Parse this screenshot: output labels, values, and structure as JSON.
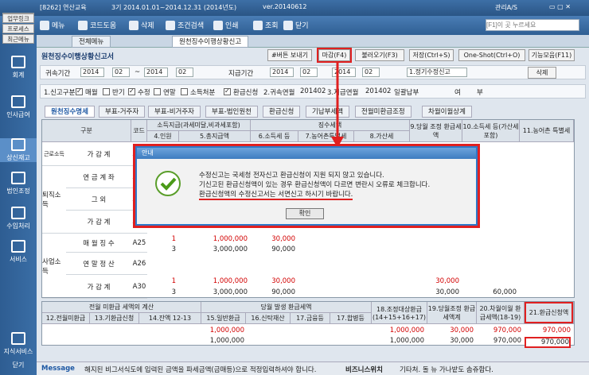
{
  "topbar": {
    "left": "[8262] 연산교육",
    "period": "3기  2014.01.01~2014.12.31  (2014년도)",
    "version": "ver.20140612",
    "user": "관리A/S"
  },
  "toolbar": {
    "menu": "메뉴",
    "code_help": "코드도움",
    "delete": "삭제",
    "filter": "조건검색",
    "print": "인쇄",
    "inquiry": "조회",
    "close": "닫기",
    "search_placeholder": "[F1]이 곳 누르세요"
  },
  "sidebar": {
    "btn1": "업무링크",
    "btn2": "프로세스",
    "btn3": "최근메뉴",
    "items": [
      "회계",
      "인사급여",
      "상신재고",
      "법인조정",
      "수입처리",
      "서비스",
      "지식서비스",
      "닫기"
    ]
  },
  "page_tabs": {
    "all": "전체메뉴",
    "active": "원천징수이행상황신고"
  },
  "form": {
    "title": "원천징수이행상황신고서",
    "btn_help": "#버튼 보내기",
    "btn_close": "마감(F4)",
    "btn_load": "불러오기(F3)",
    "btn_save": "저장(Ctrl+S)",
    "btn_oneshot": "One-Shot(Ctrl+O)",
    "btn_func": "기능모음(F11)",
    "btn_del": "삭제"
  },
  "filter": {
    "label1": "귀속기간",
    "y1": "2014",
    "m1": "02",
    "sep1": "년",
    "mon1": "월",
    "tilde": "~",
    "y2": "2014",
    "m2": "02",
    "label2": "지급기간",
    "y3": "2014",
    "m3": "02",
    "y4": "2014",
    "m4": "02",
    "right_sel": "1.정기수정신고"
  },
  "checks": {
    "c0": "1.신고구분",
    "c1": "매월",
    "c2": "반기",
    "c3": "수정",
    "c4": "연말",
    "c5": "소득처분",
    "c6": "환급신청",
    "c7": "2.귀속연월",
    "c7v": "201402",
    "c8": "3.지급연월",
    "c8v": "201402",
    "c9": "일괄납부",
    "c10": "여",
    "c11": "부"
  },
  "subtabs": [
    "원천징수명세",
    "부표-거주자",
    "부표-비거주자",
    "부표-법인원천",
    "환급신청",
    "기납부세액",
    "전월미환급조정",
    "차월이월상계"
  ],
  "grid": {
    "h_div": "구분",
    "h_code": "코드",
    "h_paid": "소득지급(과세미달,비과세포함)",
    "h_tax": "징수세액",
    "h_4": "4.인원",
    "h_5": "5.총지급액",
    "h_6": "6.소득세 등",
    "h_7": "7.농어촌특별세",
    "h_8": "8.가산세",
    "h_9": "9.당월 조정 환급세액",
    "h_10": "10.소득세 등(가산세 포함)",
    "h_11": "11.농어촌 특별세",
    "grp1": "근로소득",
    "grp2": "퇴직소득",
    "grp3": "사업소득",
    "rows": [
      {
        "name": "가 감 계",
        "code": "A10"
      },
      {
        "name": "연 금 계 좌",
        "code": "A21"
      },
      {
        "name": "그 외",
        "code": "A22"
      },
      {
        "name": "가 감 계",
        "code": "A20"
      },
      {
        "name": "매 월 징 수",
        "code": "A25",
        "n": "1",
        "amt": "1,000,000",
        "tax": "30,000"
      },
      {
        "name": "",
        "code": "",
        "n": "3",
        "amt": "3,000,000",
        "tax": "90,000"
      },
      {
        "name": "연 말 정 산",
        "code": "A26"
      },
      {
        "name": "가 감 계",
        "code": "A30",
        "n": "1",
        "amt": "1,000,000",
        "tax": "30,000",
        "adj": "30,000"
      },
      {
        "name": "",
        "code": "",
        "n": "3",
        "amt": "3,000,000",
        "tax": "90,000",
        "adj": "30,000",
        "pay": "60,000"
      }
    ]
  },
  "bottom": {
    "h1": "전월 미환급 세액의 계산",
    "h2": "당월 발생 환급세액",
    "h18": "18.조정대상환급 (14+15+16+17)",
    "h19": "19.당월조정 환급세액계",
    "h20": "20.차월이월 환급세액(18-19)",
    "h21": "21.환급신청액",
    "h12": "12.전월미환급",
    "h13": "13.기환급신청",
    "h14": "14.잔액 12-13",
    "h15": "15.일반환급",
    "h16": "16.신탁재산",
    "h17": "17.금융등",
    "h17b": "17.합병등",
    "r1": {
      "v15": "1,000,000",
      "v18": "1,000,000",
      "v19": "30,000",
      "v20": "970,000",
      "v21": "970,000"
    },
    "r2": {
      "v15": "1,000,000",
      "v18": "1,000,000",
      "v19": "30,000",
      "v20": "970,000",
      "v21": "970,000"
    }
  },
  "status": {
    "label": "Message",
    "text": "해지된 비그서식도에 입력된 금액을 파세금액(금매등)으로 적정입력하셔야 합니다.",
    "link": "비즈니스위치",
    "tip": "기타처. 돌 뉴 가나밭도 솜쥬합다."
  },
  "dialog": {
    "title": "안내",
    "line1": "수정신고는 국세청 전자신고 환급신청이 지원 되지 않고 있습니다.",
    "line2": "기신고된 환급신청액이 있는 경우 환급신청액이 다르면 변란시 오류로 체크합니다.",
    "line3": "환급신청액의 수정신고서는 서면신고 하시기 바랍니다.",
    "ok": "확인"
  },
  "colors": {
    "accent": "#2f5f93",
    "highlight": "#e02020"
  }
}
